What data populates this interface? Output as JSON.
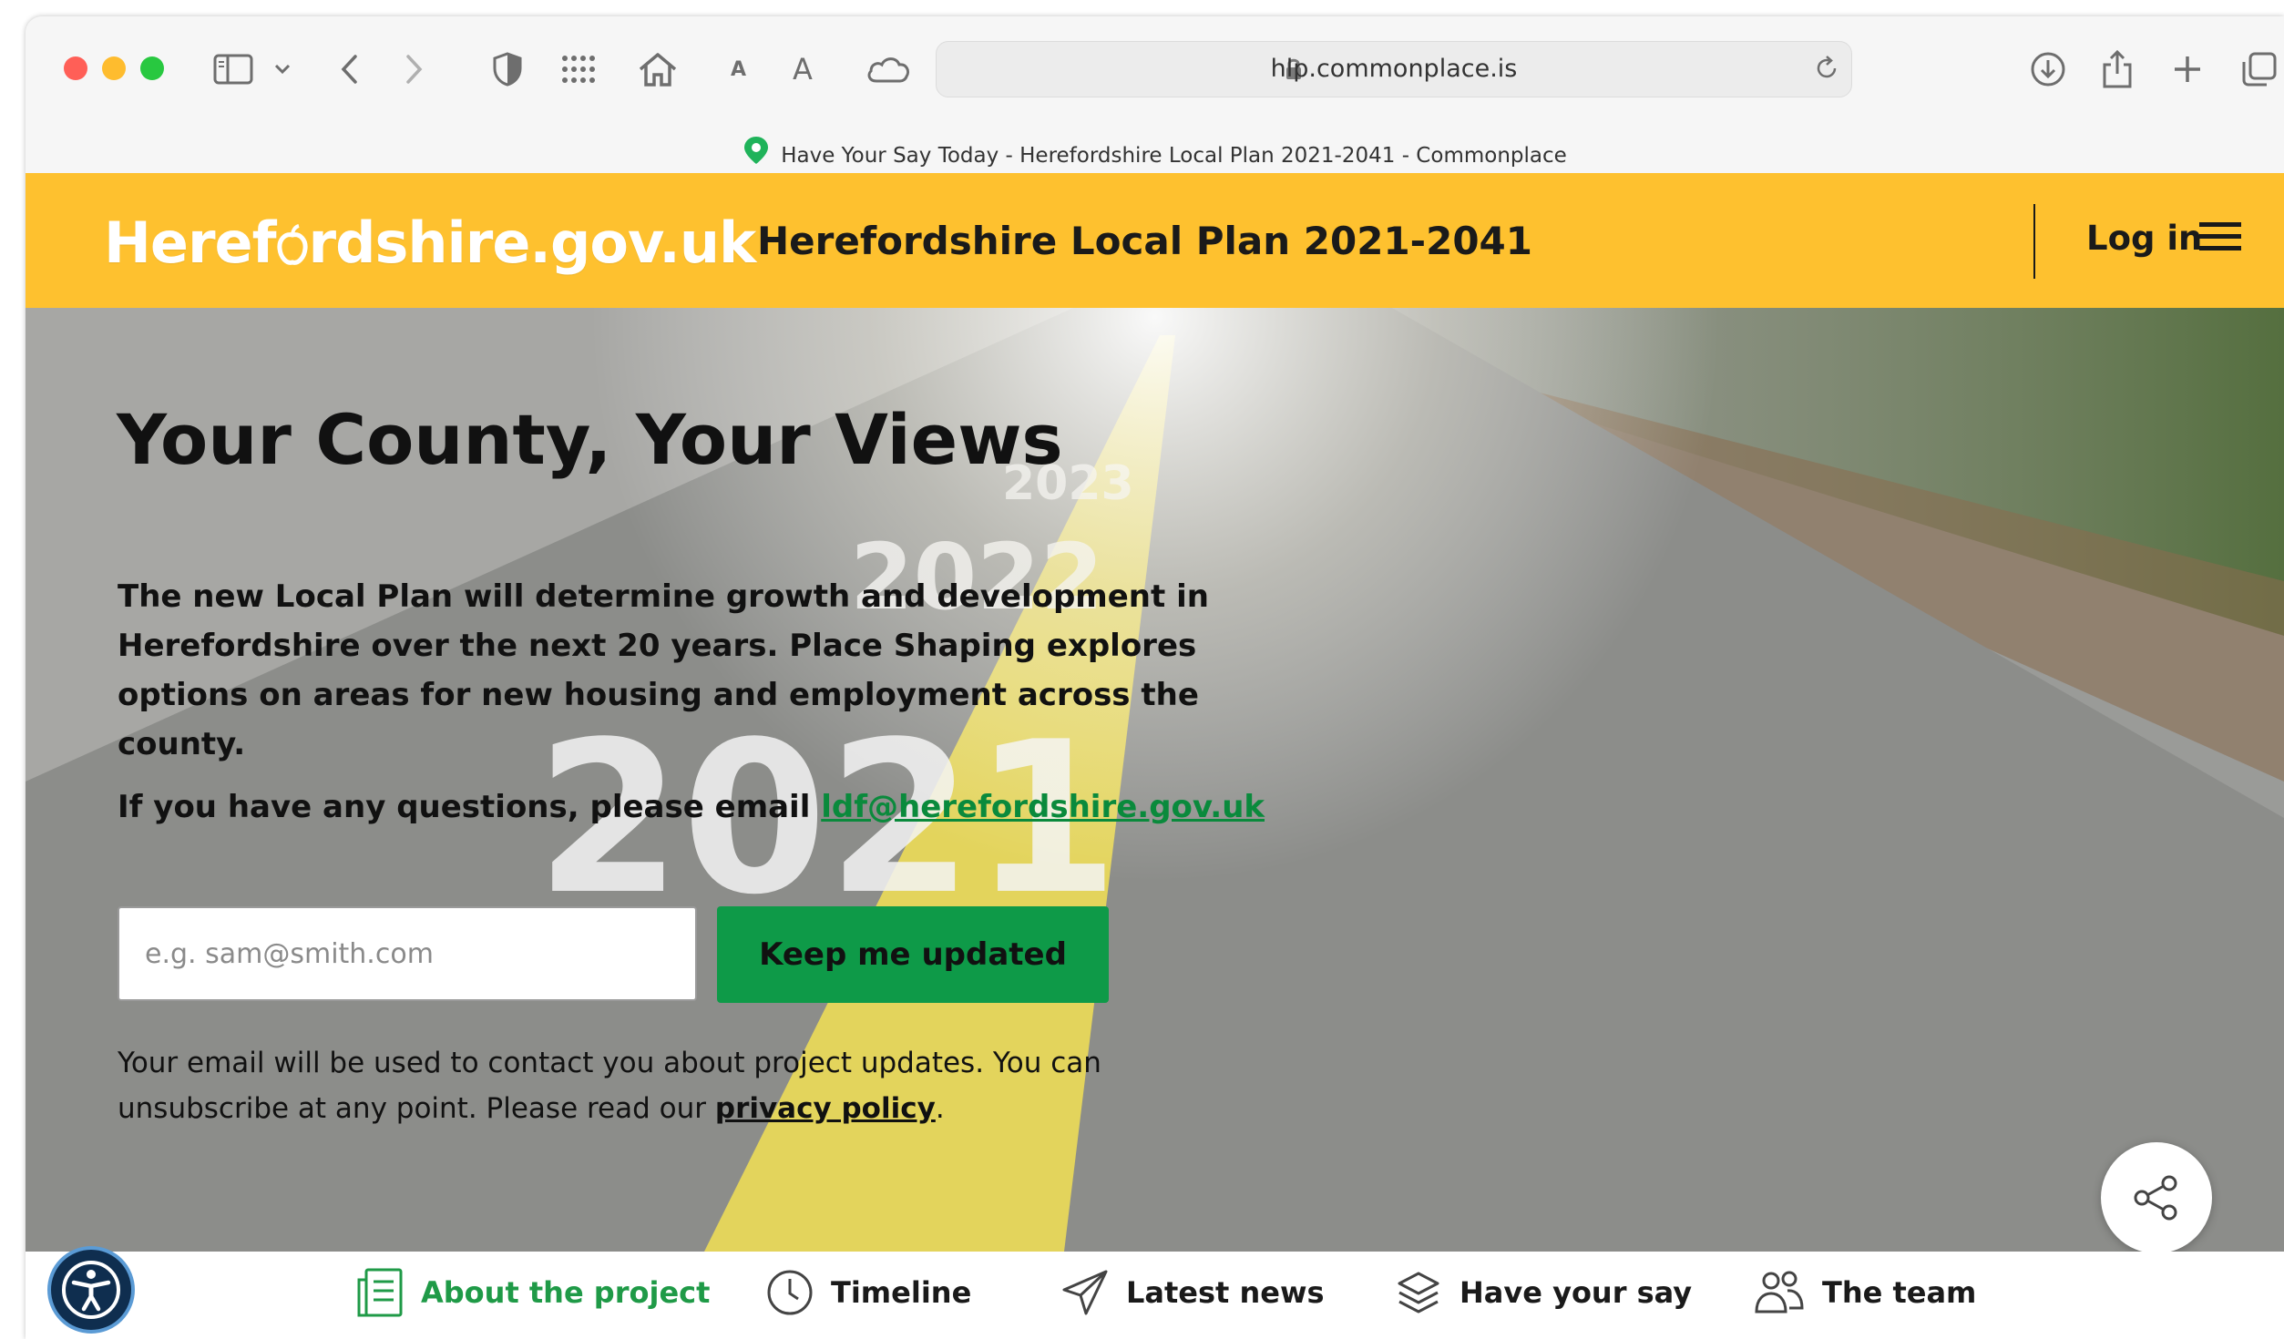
{
  "browser": {
    "url": "hlp.commonplace.is",
    "tab_title": "Have Your Say Today - Herefordshire Local Plan 2021-2041 - Commonplace"
  },
  "header": {
    "logo_text": "Heref◌rdshire.gov.uk",
    "logo_left": "Heref",
    "logo_right": "rdshire.gov.uk",
    "site_title": "Herefordshire Local Plan 2021-2041",
    "login_label": "Log in",
    "background_color": "#fec12f"
  },
  "hero": {
    "title": "Your County, Your Views",
    "body": "The new Local Plan will determine growth and development in Herefordshire over the next 20 years. Place Shaping explores options on areas for new housing and employment across the county.",
    "question_prefix": "If you have any questions, please email ",
    "email_link": "ldf@herefordshire.gov.uk",
    "email_placeholder": "e.g. sam@smith.com",
    "subscribe_button": "Keep me updated",
    "privacy_prefix": "Your email will be used to contact you about project updates. You can unsubscribe at any point. Please read our ",
    "privacy_link": "privacy policy",
    "privacy_suffix": ".",
    "road_numbers": [
      "2021",
      "2022",
      "2023"
    ],
    "accent_color": "#0e9a48"
  },
  "nav": {
    "items": [
      {
        "label": "About the project",
        "icon": "document-icon",
        "active": true
      },
      {
        "label": "Timeline",
        "icon": "clock-icon",
        "active": false
      },
      {
        "label": "Latest news",
        "icon": "paper-plane-icon",
        "active": false
      },
      {
        "label": "Have your say",
        "icon": "layers-icon",
        "active": false
      },
      {
        "label": "The team",
        "icon": "people-icon",
        "active": false
      }
    ]
  }
}
